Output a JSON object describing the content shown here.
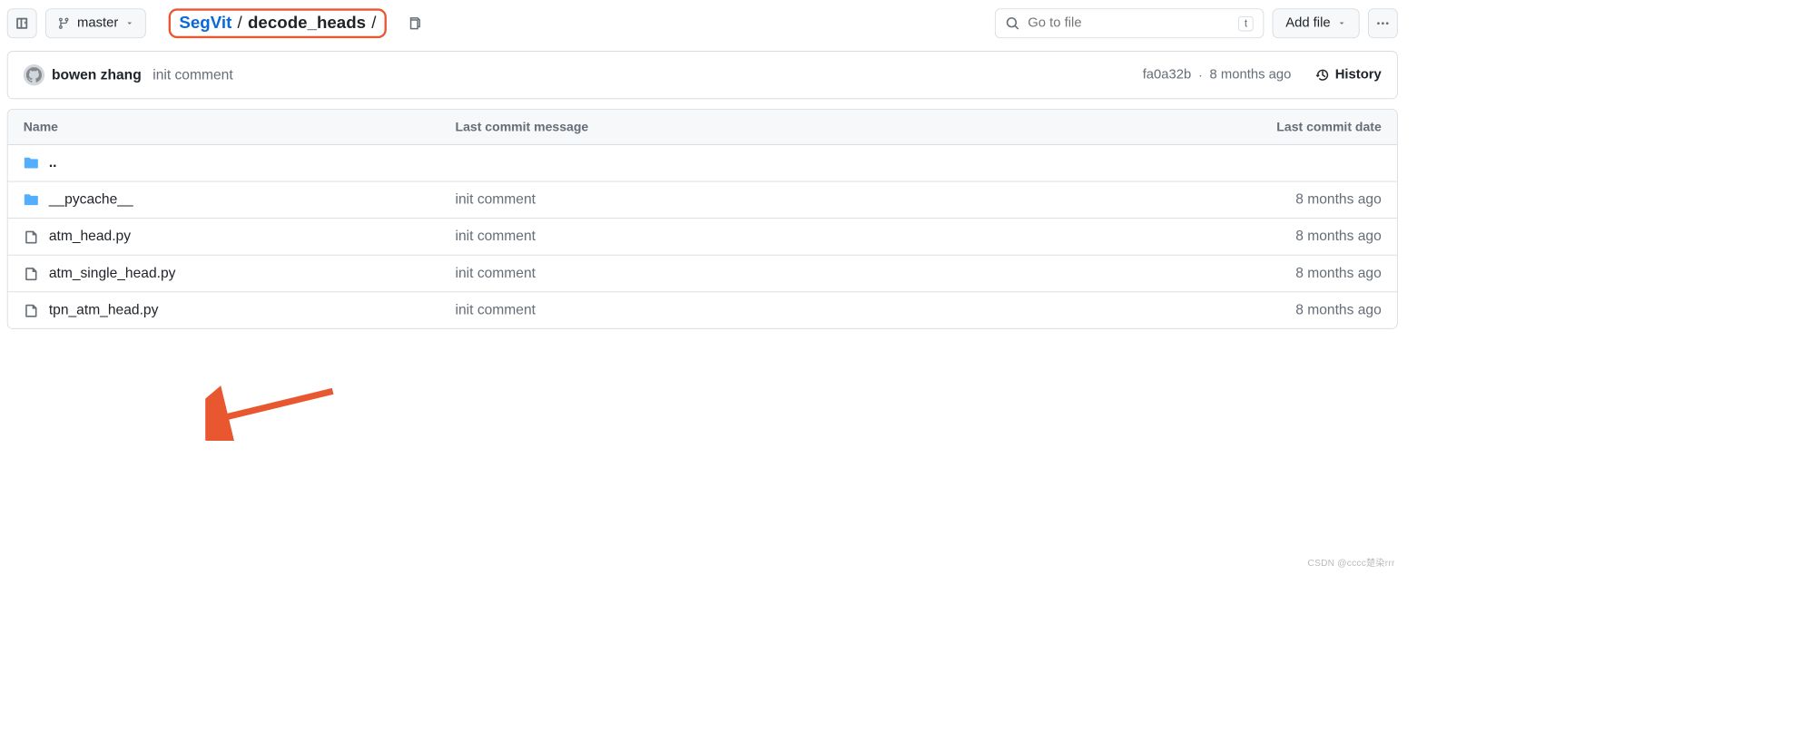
{
  "branch": {
    "name": "master"
  },
  "breadcrumb": {
    "repo": "SegVit",
    "sep": "/",
    "folder": "decode_heads",
    "trail": "/"
  },
  "search": {
    "placeholder": "Go to file",
    "kbd": "t"
  },
  "add_file": {
    "label": "Add file"
  },
  "commit": {
    "author": "bowen zhang",
    "message": "init comment",
    "sha": "fa0a32b",
    "dot": "·",
    "date": "8 months ago",
    "history_label": "History"
  },
  "table": {
    "headers": {
      "name": "Name",
      "message": "Last commit message",
      "date": "Last commit date"
    },
    "parent": "..",
    "rows": [
      {
        "type": "folder",
        "name": "__pycache__",
        "message": "init comment",
        "date": "8 months ago"
      },
      {
        "type": "file",
        "name": "atm_head.py",
        "message": "init comment",
        "date": "8 months ago"
      },
      {
        "type": "file",
        "name": "atm_single_head.py",
        "message": "init comment",
        "date": "8 months ago"
      },
      {
        "type": "file",
        "name": "tpn_atm_head.py",
        "message": "init comment",
        "date": "8 months ago"
      }
    ]
  },
  "watermark": "CSDN @cccc楚染rrr"
}
